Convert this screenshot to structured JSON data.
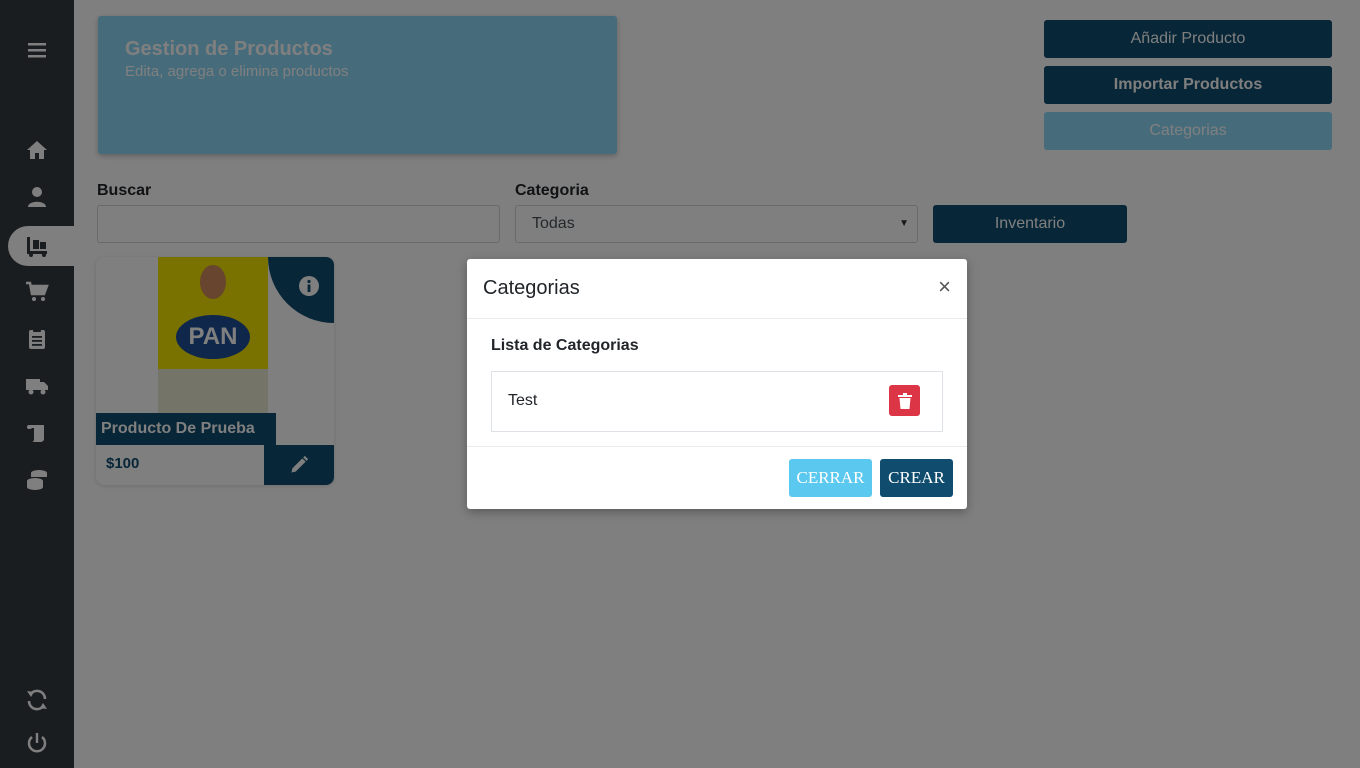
{
  "sidebar": {
    "items": [
      {
        "icon": "menu-icon"
      },
      {
        "icon": "home-icon"
      },
      {
        "icon": "user-icon"
      },
      {
        "icon": "dolly-icon",
        "active": true
      },
      {
        "icon": "cart-icon"
      },
      {
        "icon": "clipboard-icon"
      },
      {
        "icon": "truck-icon"
      },
      {
        "icon": "scroll-icon"
      },
      {
        "icon": "coins-icon"
      },
      {
        "icon": "sync-icon"
      },
      {
        "icon": "power-icon"
      }
    ]
  },
  "header": {
    "title": "Gestion de Productos",
    "subtitle": "Edita, agrega o elimina productos"
  },
  "actions": {
    "add_product": "Añadir Producto",
    "import_products": "Importar Productos",
    "categories": "Categorias"
  },
  "filters": {
    "search_label": "Buscar",
    "search_value": "",
    "category_label": "Categoria",
    "category_selected": "Todas",
    "inventory_button": "Inventario"
  },
  "products": [
    {
      "name": "Producto De Prueba",
      "price": "$100",
      "image_text": "PAN"
    }
  ],
  "modal": {
    "title": "Categorias",
    "close_symbol": "×",
    "list_title": "Lista de Categorias",
    "categories": [
      "Test"
    ],
    "close_button": "CERRAR",
    "create_button": "CREAR"
  },
  "colors": {
    "sidebar": "#343a40",
    "primary_dark": "#0f4c6e",
    "primary_light": "#8dd8f8",
    "danger": "#dc3545",
    "info": "#5bc8ef"
  }
}
